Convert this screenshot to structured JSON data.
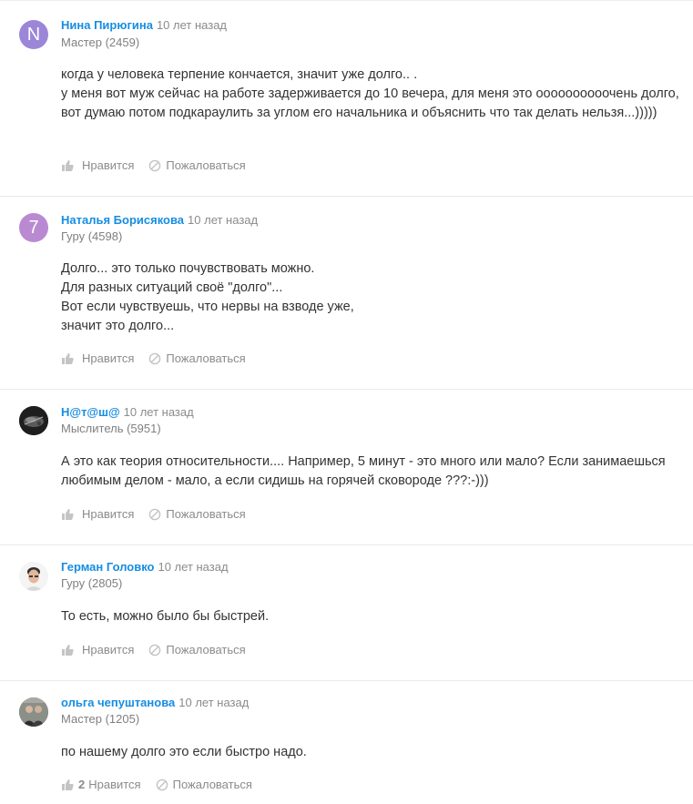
{
  "answers": [
    {
      "author": "Нина Пирюгина",
      "time": "10 лет назад",
      "rank": "Мастер (2459)",
      "avatar_letter": "N",
      "avatar_color": "#9b86d8",
      "lines": [
        "когда у человека терпение кончается, значит уже долго.. .",
        "у меня вот муж сейчас на работе задерживается до 10 вечера, для меня это оооооооооочень долго, вот думаю потом подкараулить за углом его начальника и объяснить что так делать нельзя...)))))"
      ],
      "like_label": "Нравится",
      "like_count": "",
      "report_label": "Пожаловаться"
    },
    {
      "author": "Наталья Борисякова",
      "time": "10 лет назад",
      "rank": "Гуру (4598)",
      "avatar_letter": "7",
      "avatar_color": "#b98ad2",
      "lines": [
        "Долго... это только почувствовать можно.",
        "Для разных ситуаций своё \"долго\"...",
        "Вот если чувствуешь, что нервы на взводе уже,",
        "значит это долго..."
      ],
      "like_label": "Нравится",
      "like_count": "",
      "report_label": "Пожаловаться"
    },
    {
      "author": "Н@т@ш@",
      "time": "10 лет назад",
      "rank": "Мыслитель (5951)",
      "avatar_letter": "",
      "avatar_color": "#232323",
      "lines": [
        "А это как теория относительности.... Например, 5 минут - это много или мало? Если занимаешься любимым делом - мало, а если сидишь на горячей сковороде ???:-)))"
      ],
      "like_label": "Нравится",
      "like_count": "",
      "report_label": "Пожаловаться"
    },
    {
      "author": "Герман Головко",
      "time": "10 лет назад",
      "rank": "Гуру (2805)",
      "avatar_letter": "",
      "avatar_color": "#f2f2f2",
      "lines": [
        "То есть, можно было бы быстрей."
      ],
      "like_label": "Нравится",
      "like_count": "",
      "report_label": "Пожаловаться"
    },
    {
      "author": "ольга чепуштанова",
      "time": "10 лет назад",
      "rank": "Мастер (1205)",
      "avatar_letter": "",
      "avatar_color": "#6f6f6f",
      "lines": [
        "по нашему долго это если быстро надо."
      ],
      "like_label": "Нравится",
      "like_count": "2",
      "report_label": "Пожаловаться"
    }
  ]
}
